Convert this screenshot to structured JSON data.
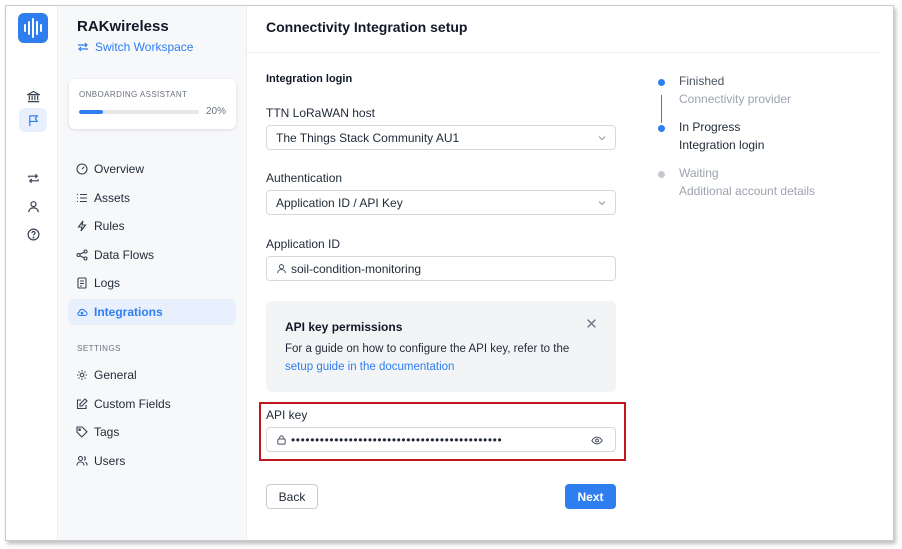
{
  "org": {
    "name": "RAKwireless",
    "switch_label": "Switch Workspace"
  },
  "onboarding": {
    "title": "ONBOARDING ASSISTANT",
    "percent_label": "20%",
    "progress": 0.2
  },
  "nav": {
    "items": [
      {
        "label": "Overview",
        "icon": "gauge-icon"
      },
      {
        "label": "Assets",
        "icon": "list-icon"
      },
      {
        "label": "Rules",
        "icon": "bolt-icon"
      },
      {
        "label": "Data Flows",
        "icon": "share-icon"
      },
      {
        "label": "Logs",
        "icon": "document-icon"
      },
      {
        "label": "Integrations",
        "icon": "cloud-icon",
        "active": true
      }
    ],
    "settings_label": "SETTINGS",
    "settings_items": [
      {
        "label": "General",
        "icon": "gear-icon"
      },
      {
        "label": "Custom Fields",
        "icon": "edit-icon"
      },
      {
        "label": "Tags",
        "icon": "tag-icon"
      },
      {
        "label": "Users",
        "icon": "users-icon"
      }
    ]
  },
  "page": {
    "title": "Connectivity Integration setup"
  },
  "form": {
    "section_title": "Integration login",
    "host": {
      "label": "TTN LoRaWAN host",
      "value": "The Things Stack Community AU1"
    },
    "auth": {
      "label": "Authentication",
      "value": "Application ID / API Key"
    },
    "app_id": {
      "label": "Application ID",
      "value": "soil-condition-monitoring"
    },
    "info": {
      "title": "API key permissions",
      "body": "For a guide on how to configure the API key, refer to the",
      "link": "setup guide in the documentation"
    },
    "api_key": {
      "label": "API key",
      "value": "••••••••••••••••••••••••••••••••••••••••••••"
    },
    "back_label": "Back",
    "next_label": "Next"
  },
  "steps": [
    {
      "status": "Finished",
      "name": "Connectivity provider"
    },
    {
      "status": "In Progress",
      "name": "Integration login"
    },
    {
      "status": "Waiting",
      "name": "Additional account details"
    }
  ],
  "colors": {
    "accent": "#2f7ef0",
    "highlight": "#c0181f",
    "muted": "#9ca3af"
  }
}
